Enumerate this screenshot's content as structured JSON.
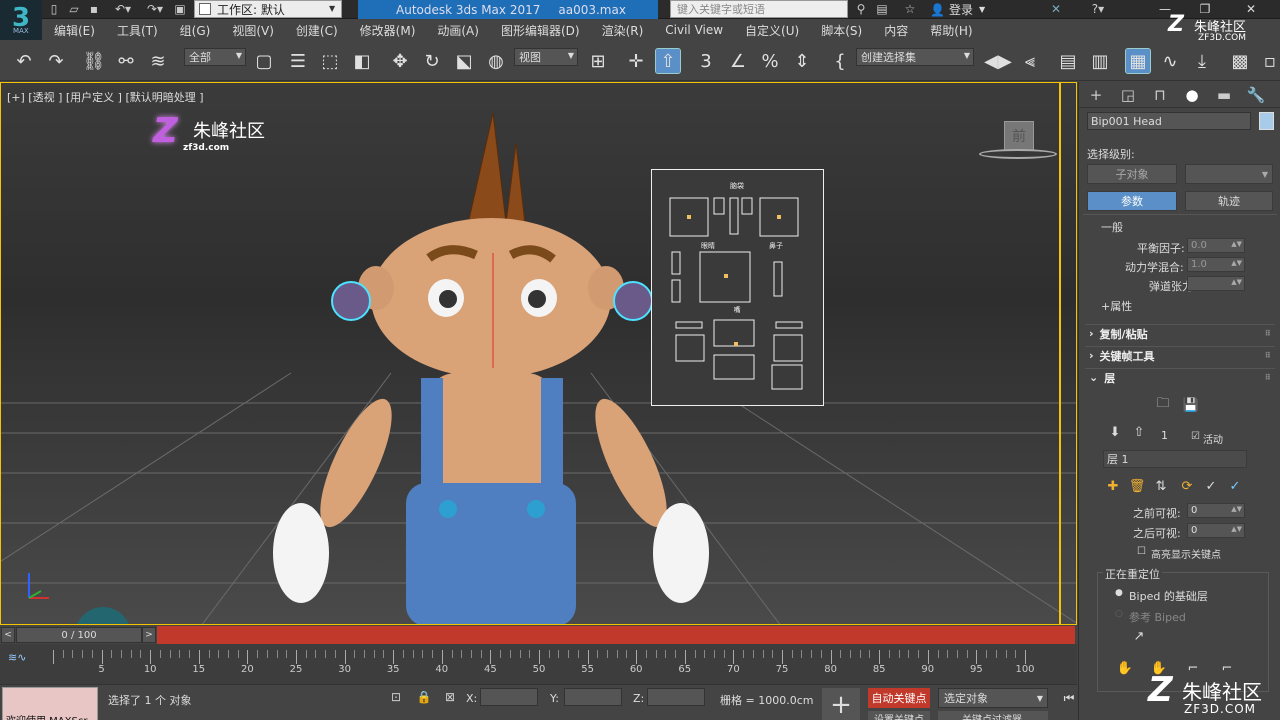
{
  "titlebar": {
    "workspace_label": "工作区: 默认",
    "app_title": "Autodesk 3ds Max 2017",
    "file_name": "aa003.max",
    "search_placeholder": "键入关键字或短语",
    "login_label": "登录"
  },
  "menu": [
    "编辑(E)",
    "工具(T)",
    "组(G)",
    "视图(V)",
    "创建(C)",
    "修改器(M)",
    "动画(A)",
    "图形编辑器(D)",
    "渲染(R)",
    "Civil View",
    "自定义(U)",
    "脚本(S)",
    "内容",
    "帮助(H)"
  ],
  "toolbar": {
    "filter_dropdown": "全部",
    "coord_dropdown": "视图",
    "selection_set_dropdown": "创建选择集",
    "snap_label": "3"
  },
  "viewport": {
    "label": "[+] [透视 ] [用户定义 ] [默认明暗处理 ]",
    "viewcube_face": "前",
    "watermark_cn": "朱峰社区",
    "watermark_url": "zf3d.com",
    "sel_panel_labels": [
      "脑袋",
      "眼睛",
      "鼻子",
      "嘴"
    ]
  },
  "timeline": {
    "frame_display": "0 / 100",
    "prev": "<",
    "next": ">",
    "tick_labels": [
      "0",
      "5",
      "10",
      "15",
      "20",
      "25",
      "30",
      "35",
      "40",
      "45",
      "50",
      "55",
      "60",
      "65",
      "70",
      "75",
      "80",
      "85",
      "90",
      "95",
      "100"
    ]
  },
  "status": {
    "maxscript_text": "欢迎使用 MAXScr",
    "selection_info": "选择了 1 个 对象",
    "prompt": "",
    "x_label": "X:",
    "y_label": "Y:",
    "z_label": "Z:",
    "grid_label": "栅格 = 1000.0cm",
    "autokey_label": "自动关键点",
    "setkey_label": "设置关键点",
    "selected_object": "选定对象",
    "key_filter": "关键点过滤器..."
  },
  "command_panel": {
    "object_name": "Bip001 Head",
    "selection_level_label": "选择级别:",
    "sub_object_button": "子对象",
    "params_button": "参数",
    "trajectory_button": "轨迹",
    "general_label": "一般",
    "balance_label": "平衡因子:",
    "balance_value": "0.0",
    "dynamics_label": "动力学混合:",
    "dynamics_value": "1.0",
    "ballistic_label": "弹道张力:",
    "ballistic_value": "",
    "attributes_label": "+属性",
    "rollout_copy_paste": "复制/粘贴",
    "rollout_keyframe_tools": "关键帧工具",
    "rollout_layers": "层",
    "layer_number": "1",
    "active_label": "活动",
    "layer_name": "层 1",
    "before_visible_label": "之前可视:",
    "before_visible_value": "0",
    "after_visible_label": "之后可视:",
    "after_visible_value": "0",
    "highlight_keys_label": "高亮显示关键点",
    "retarget_group_label": "正在重定位",
    "biped_base_layer": "Biped 的基础层",
    "reference_biped": "参考 Biped"
  },
  "watermarks": {
    "bottom_right_cn": "朱峰社区",
    "bottom_right_url": "ZF3D.COM",
    "top_right_cn": "朱峰社区",
    "top_right_url": "ZF3D.COM"
  },
  "colors": {
    "accent_blue": "#5b8fc7",
    "autokey_red": "#c0392b",
    "viewport_border": "#f5c400",
    "title_blue": "#1f6fb8"
  }
}
